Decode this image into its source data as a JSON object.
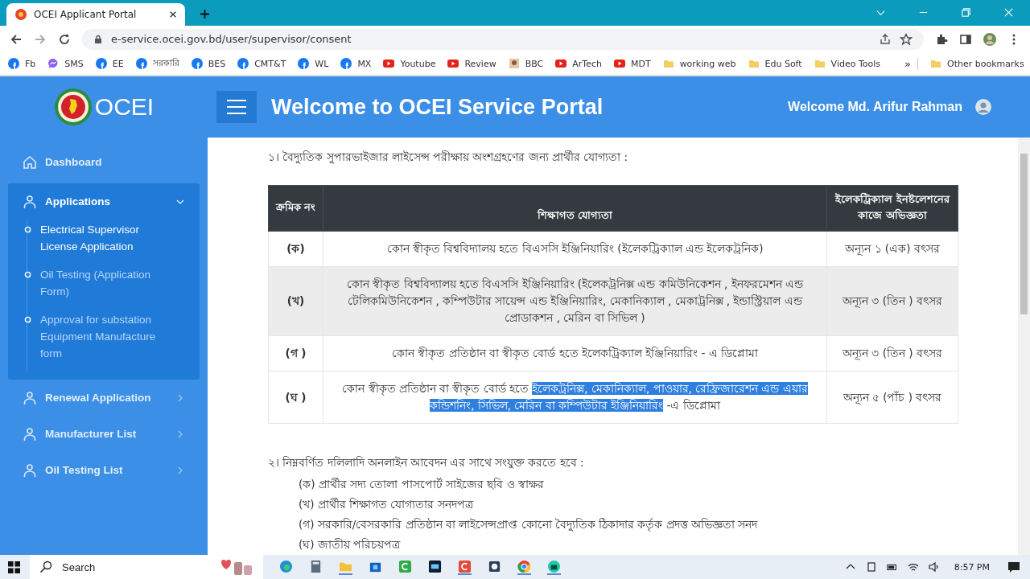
{
  "browser": {
    "tab_title": "OCEI Applicant Portal",
    "url": "e-service.ocei.gov.bd/user/supervisor/consent",
    "bookmarks": [
      {
        "label": "Fb",
        "kind": "round"
      },
      {
        "label": "SMS",
        "kind": "chat"
      },
      {
        "label": "EE",
        "kind": "round"
      },
      {
        "label": "সরকারি",
        "kind": "round"
      },
      {
        "label": "BES",
        "kind": "round"
      },
      {
        "label": "CMT&T",
        "kind": "round"
      },
      {
        "label": "WL",
        "kind": "round"
      },
      {
        "label": "MX",
        "kind": "round"
      },
      {
        "label": "Youtube",
        "kind": "play"
      },
      {
        "label": "Review",
        "kind": "play"
      },
      {
        "label": "BBC",
        "kind": "picture"
      },
      {
        "label": "ArTech",
        "kind": "play"
      },
      {
        "label": "MDT",
        "kind": "play"
      },
      {
        "label": "working web",
        "kind": "folder"
      },
      {
        "label": "Edu Soft",
        "kind": "folder"
      },
      {
        "label": "Video Tools",
        "kind": "folder"
      }
    ],
    "more_bookmarks": "»",
    "other_bookmarks": "Other bookmarks"
  },
  "header": {
    "logo": "OCEI",
    "title": "Welcome to OCEI Service Portal",
    "user": "Welcome Md. Arifur Rahman"
  },
  "sidebar": {
    "dashboard": "Dashboard",
    "groups": [
      {
        "label": "Applications",
        "expanded": true,
        "children": [
          {
            "label": "Electrical Supervisor License Application",
            "selected": true
          },
          {
            "label": "Oil Testing (Application Form)",
            "selected": false
          },
          {
            "label": "Approval for substation Equipment Manufacture form",
            "selected": false
          }
        ]
      },
      {
        "label": "Renewal Application",
        "expanded": false
      },
      {
        "label": "Manufacturer List",
        "expanded": false
      },
      {
        "label": "Oil Testing List",
        "expanded": false
      }
    ]
  },
  "section_1": {
    "heading": "১। বৈদ্যুতিক সুপারভাইজার লাইসেন্স পরীক্ষায় অংশগ্রহণের জন্য প্রার্থীর যোগ্যতা :",
    "table": {
      "columns": [
        "ক্রমিক নং",
        "শিক্ষাগত যোগ্যতা",
        "ইলেকট্রিক্যাল ইনষ্টলেশনের কাজে অভিজ্ঞতা"
      ],
      "rows": [
        {
          "serial": "(ক)",
          "hovered": false,
          "qualification": [
            {
              "text": "কোন স্বীকৃত বিশ্ববিদ্যালয় হতে বিএসসি ইঞ্জিনিয়ারিং (ইলেকট্রিক্যাল এন্ড ইলেকট্রনিক)",
              "highlighted": false
            }
          ],
          "experience": "অন্যূন ১ (এক) বৎসর"
        },
        {
          "serial": "(খ)",
          "hovered": true,
          "qualification": [
            {
              "text": "কোন স্বীকৃত বিশ্ববিদ্যালয় হতে বিএসসি ইঞ্জিনিয়ারিং (ইলেকট্রনিক্স এন্ড কমিউনিকেশন , ইনফরমেশন এন্ড টেলিকমিউনিকেশন , কম্পিউটার সায়েন্স এন্ড ইঞ্জিনিয়ারিং, মেকানিক্যাল , মেকাট্রনিক্স , ইন্ডাস্ট্রিয়াল এন্ড প্রোডাকশন , মেরিন বা সিভিল )",
              "highlighted": false
            }
          ],
          "experience": "অন্যূন ৩ (তিন ) বৎসর"
        },
        {
          "serial": "(গ )",
          "hovered": false,
          "qualification": [
            {
              "text": "কোন স্বীকৃত প্রতিষ্ঠান বা স্বীকৃত বোর্ড হতে ইলেকট্রিক্যাল ইঞ্জিনিয়ারিং - এ ডিপ্লোমা",
              "highlighted": false
            }
          ],
          "experience": "অন্যূন ৩ (তিন ) বৎসর"
        },
        {
          "serial": "(ঘ )",
          "hovered": false,
          "qualification": [
            {
              "text": "কোন স্বীকৃত প্রতিষ্ঠান বা স্বীকৃত বোর্ড হতে ",
              "highlighted": false
            },
            {
              "text": "ইলেকট্রনিক্স, মেকানিক্যাল, পাওয়ার, রেফ্রিজারেশন এন্ড এয়ার কন্ডিশনিং, সিভিল, মেরিন বা কম্পিউটার ইঞ্জিনিয়ারিং",
              "highlighted": true
            },
            {
              "text": " -এ ডিপ্লোমা",
              "highlighted": false
            }
          ],
          "experience": "অন্যূন ৫ (পাঁচ ) বৎসর"
        }
      ]
    }
  },
  "section_2": {
    "heading": "২। নিম্নবর্ণিত দলিলাদি অনলাইন আবেদন এর সাথে সংযুক্ত করতে হবে :",
    "items": [
      "(ক) প্রার্থীর সদ্য তোলা পাসপোর্ট সাইজের ছবি ও স্বাক্ষর",
      "(খ) প্রার্থীর শিক্ষাগত যোগ্যতার সনদপত্র",
      "(গ) সরকারি/বেসরকারি প্রতিষ্ঠান বা লাইসেন্সপ্রাপ্ত কোনো বৈদ্যুতিক ঠিকাদার কর্তৃক প্রদত্ত অভিজ্ঞতা সনদ",
      "(ঘ) জাতীয় পরিচয়পত্র"
    ]
  },
  "taskbar": {
    "search_placeholder": "Search",
    "time": "8:57 PM"
  }
}
